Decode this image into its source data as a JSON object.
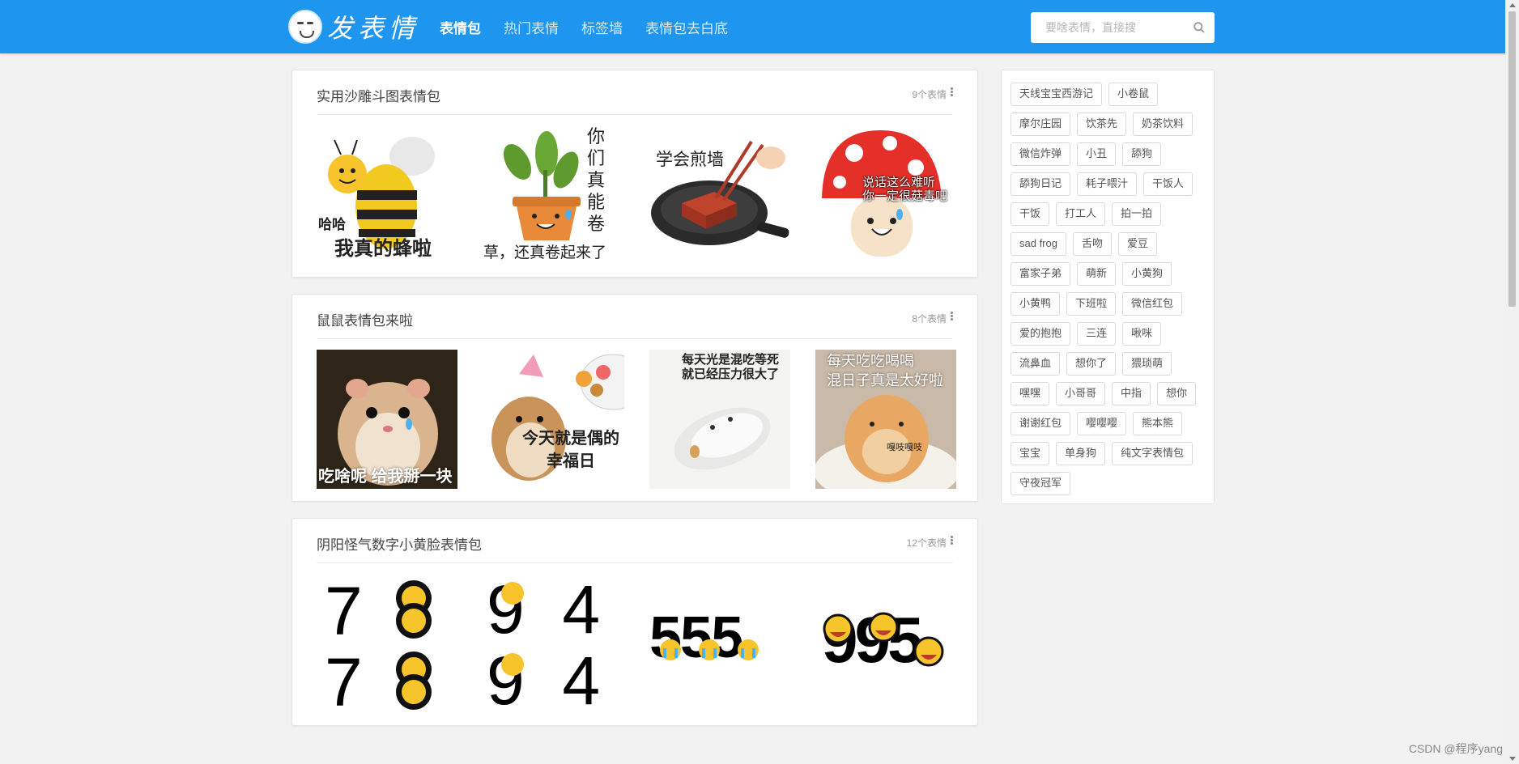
{
  "header": {
    "logo_text": "发表情",
    "nav": [
      "表情包",
      "热门表情",
      "标签墙",
      "表情包去白底"
    ],
    "search_placeholder": "要啥表情，直接搜"
  },
  "albums": [
    {
      "title": "实用沙雕斗图表情包",
      "count": "9个表情",
      "captions": [
        [
          "哈哈",
          "我真的蜂啦"
        ],
        [
          "你",
          "们",
          "真",
          "能",
          "卷",
          "草，还真卷起来了"
        ],
        [
          "学会煎墙"
        ],
        [
          "说话这么难听",
          "你一定很菇毒吧"
        ]
      ]
    },
    {
      "title": "鼠鼠表情包来啦",
      "count": "8个表情",
      "captions": [
        [
          "吃啥呢 给我掰一块"
        ],
        [
          "今天就是偶的",
          "幸福日"
        ],
        [
          "每天光是混吃等死",
          "就已经压力很大了"
        ],
        [
          "每天吃吃喝喝",
          "混日子真是太好啦",
          "嘎吱嘎吱"
        ]
      ]
    },
    {
      "title": "阴阳怪气数字小黄脸表情包",
      "count": "12个表情",
      "captions": [
        [
          "7",
          "7"
        ],
        [
          "9",
          "4",
          "9",
          "4"
        ],
        [
          "555"
        ],
        [
          "995"
        ]
      ]
    }
  ],
  "sidebar_tags": [
    "天线宝宝西游记",
    "小卷鼠",
    "摩尔庄园",
    "饮茶先",
    "奶茶饮料",
    "微信炸弹",
    "小丑",
    "舔狗",
    "舔狗日记",
    "耗子喂汁",
    "干饭人",
    "干饭",
    "打工人",
    "拍一拍",
    "sad frog",
    "舌吻",
    "爱豆",
    "富家子弟",
    "萌新",
    "小黄狗",
    "小黄鸭",
    "下班啦",
    "微信红包",
    "爱的抱抱",
    "三连",
    "啾咪",
    "流鼻血",
    "想你了",
    "猥琐萌",
    "嘿嘿",
    "小哥哥",
    "中指",
    "想你",
    "谢谢红包",
    "嘤嘤嘤",
    "熊本熊",
    "宝宝",
    "单身狗",
    "纯文字表情包",
    "守夜冠军"
  ],
  "watermark": "CSDN @程序yang",
  "colors": {
    "header": "#1e96f0",
    "page_bg": "#f2f2f2"
  }
}
